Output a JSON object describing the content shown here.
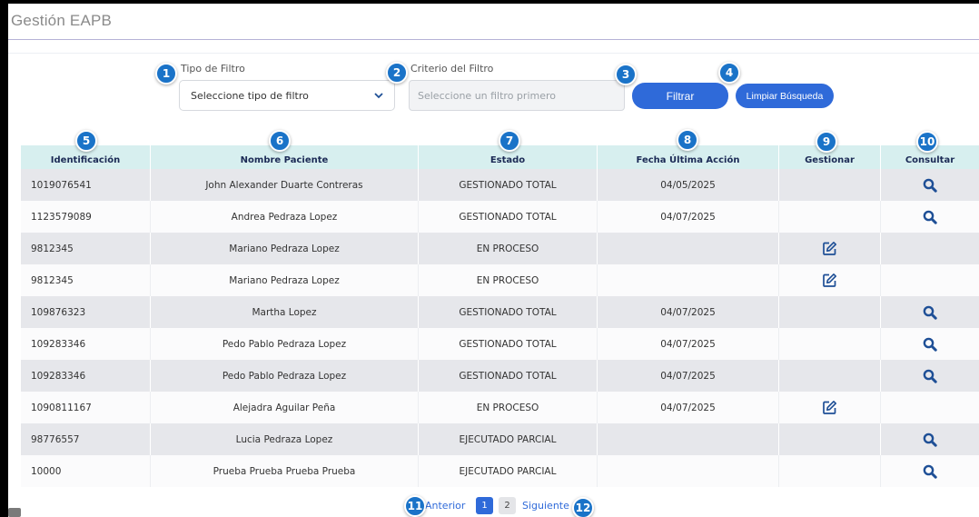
{
  "page": {
    "title": "Gestión EAPB"
  },
  "filters": {
    "tipo_label": "Tipo de Filtro",
    "tipo_value": "Seleccione tipo de filtro",
    "criterio_label": "Criterio del Filtro",
    "criterio_placeholder": "Seleccione un filtro primero",
    "filtrar_label": "Filtrar",
    "limpiar_label": "Limpiar Búsqueda"
  },
  "badges": [
    "1",
    "2",
    "3",
    "4",
    "5",
    "6",
    "7",
    "8",
    "9",
    "10",
    "11",
    "12"
  ],
  "table": {
    "headers": [
      "Identificación",
      "Nombre Paciente",
      "Estado",
      "Fecha Última Acción",
      "Gestionar",
      "Consultar"
    ],
    "rows": [
      {
        "id": "1019076541",
        "nombre": "John Alexander Duarte Contreras",
        "estado": "GESTIONADO TOTAL",
        "fecha": "04/05/2025",
        "gestionar": "",
        "consultar": "search-icon"
      },
      {
        "id": "1123579089",
        "nombre": "Andrea Pedraza Lopez",
        "estado": "GESTIONADO TOTAL",
        "fecha": "04/07/2025",
        "gestionar": "",
        "consultar": "search-icon"
      },
      {
        "id": "9812345",
        "nombre": "Mariano Pedraza Lopez",
        "estado": "EN PROCESO",
        "fecha": "",
        "gestionar": "edit-icon",
        "consultar": ""
      },
      {
        "id": "9812345",
        "nombre": "Mariano Pedraza Lopez",
        "estado": "EN PROCESO",
        "fecha": "",
        "gestionar": "edit-icon",
        "consultar": ""
      },
      {
        "id": "109876323",
        "nombre": "Martha Lopez",
        "estado": "GESTIONADO TOTAL",
        "fecha": "04/07/2025",
        "gestionar": "",
        "consultar": "search-icon"
      },
      {
        "id": "109283346",
        "nombre": "Pedo Pablo Pedraza Lopez",
        "estado": "GESTIONADO TOTAL",
        "fecha": "04/07/2025",
        "gestionar": "",
        "consultar": "search-icon"
      },
      {
        "id": "109283346",
        "nombre": "Pedo Pablo Pedraza Lopez",
        "estado": "GESTIONADO TOTAL",
        "fecha": "04/07/2025",
        "gestionar": "",
        "consultar": "search-icon"
      },
      {
        "id": "1090811167",
        "nombre": "Alejadra Aguilar Peña",
        "estado": "EN PROCESO",
        "fecha": "04/07/2025",
        "gestionar": "edit-icon",
        "consultar": ""
      },
      {
        "id": "98776557",
        "nombre": "Lucia Pedraza Lopez",
        "estado": "EJECUTADO PARCIAL",
        "fecha": "",
        "gestionar": "",
        "consultar": "search-icon"
      },
      {
        "id": "10000",
        "nombre": "Prueba Prueba Prueba Prueba",
        "estado": "EJECUTADO PARCIAL",
        "fecha": "",
        "gestionar": "",
        "consultar": "search-icon"
      }
    ]
  },
  "pagination": {
    "prev_label": "Anterior",
    "pages": [
      "1",
      "2"
    ],
    "current_page": "1",
    "next_label": "Siguiente"
  },
  "colors": {
    "accent": "#2f6ad9",
    "badge": "#1a73c8",
    "header_bg": "#d7efef",
    "icon": "#1e4f96"
  }
}
